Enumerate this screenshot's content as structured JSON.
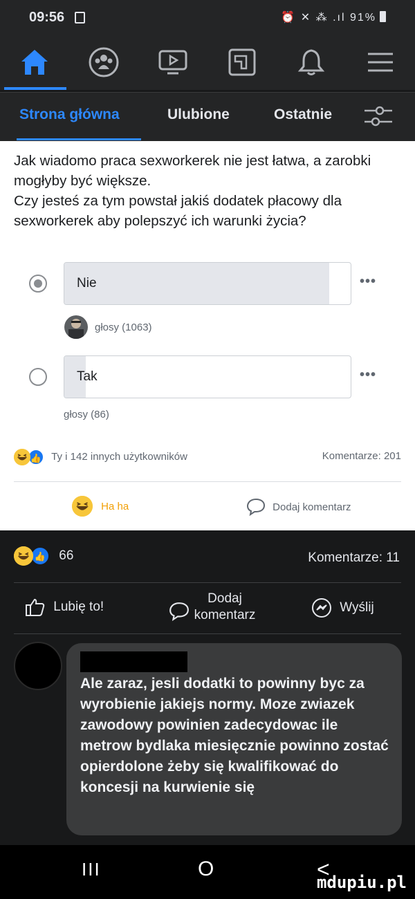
{
  "status_bar": {
    "time": "09:56",
    "signal_text": "⏰ ✕ ⁂ .ıl",
    "battery": "91%"
  },
  "nav": {
    "icons": [
      "home-icon",
      "groups-icon",
      "watch-icon",
      "pages-icon",
      "notifications-icon",
      "menu-icon"
    ],
    "active_index": 0
  },
  "tabs": {
    "home": "Strona główna",
    "favorites": "Ulubione",
    "recent": "Ostatnie"
  },
  "post": {
    "question": "Jak wiadomo praca sexworkerek nie jest łatwa, a zarobki mogłyby być większe.\nCzy jesteś za tym powstał jakiś dodatek płacowy dla sexworkerek aby polepszyć ich warunki życia?",
    "options": [
      {
        "label": "Nie",
        "votes_text": "głosy (1063)",
        "selected": true,
        "share": 0.925
      },
      {
        "label": "Tak",
        "votes_text": "głosy (86)",
        "selected": false,
        "share": 0.075
      }
    ],
    "more": "•••",
    "reactions_text": "Ty i 142 innych użytkowników",
    "comments_count_text": "Komentarze: 201",
    "reaction_button": "Ha ha",
    "comment_button": "Dodaj komentarz"
  },
  "post2": {
    "reactions_count": "66",
    "comments_count_text": "Komentarze: 11",
    "like_button": "Lubię to!",
    "comment_button": "Dodaj komentarz",
    "send_button": "Wyślij"
  },
  "comment": {
    "text": "Ale zaraz, jesli dodatki to powinny byc za wyrobienie jakiejs normy. Moze zwiazek zawodowy powinien zadecydowac ile metrow bydlaka miesięcznie powinno zostać opierdolone żeby się kwalifikować do koncesji na kurwienie się"
  },
  "system_nav": {
    "recent": "III",
    "home": "O",
    "back": "<"
  },
  "watermark": "mdupiu.pl",
  "colors": {
    "accent": "#2d88ff",
    "dark_bg": "#18191a",
    "bar_bg": "#242526",
    "bubble": "#3a3b3c"
  }
}
